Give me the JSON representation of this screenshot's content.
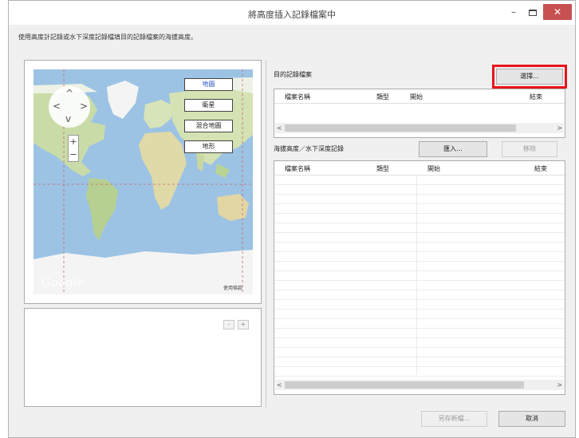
{
  "window": {
    "title": "將高度插入記錄檔案中",
    "controls": {
      "minimize": "–",
      "close": "✕"
    }
  },
  "instruction": "使用高度計記錄或水下深度記錄檔填目的記錄檔案的海拔高度。",
  "map": {
    "types": [
      "地圖",
      "衛星",
      "混合地圖",
      "地形"
    ],
    "active_type": "地圖",
    "zoom_in": "+",
    "zoom_out": "−",
    "pan_arrows": {
      "up": "^",
      "down": "v",
      "left": "<",
      "right": ">"
    },
    "logo": "Google",
    "terms": "使用條款"
  },
  "lower_panel": {
    "minus": "-",
    "plus": "+"
  },
  "target": {
    "label": "目的記錄檔案",
    "select_button": "選擇...",
    "columns": [
      "檔案名稱",
      "類型",
      "開始",
      "結束"
    ],
    "scroll_left": "<",
    "scroll_right": ">"
  },
  "source": {
    "label": "海拔高度／水下深度記錄",
    "import_button": "匯入...",
    "remove_button": "移除",
    "columns": [
      "檔案名稱",
      "類型",
      "開始",
      "結束"
    ],
    "scroll_left": "<",
    "scroll_right": ">"
  },
  "footer": {
    "save_as_button": "另存新檔...",
    "cancel_button": "取消"
  },
  "colors": {
    "highlight": "#e8141a",
    "close_button": "#c75050",
    "active_map_type": "#2a56c6"
  }
}
